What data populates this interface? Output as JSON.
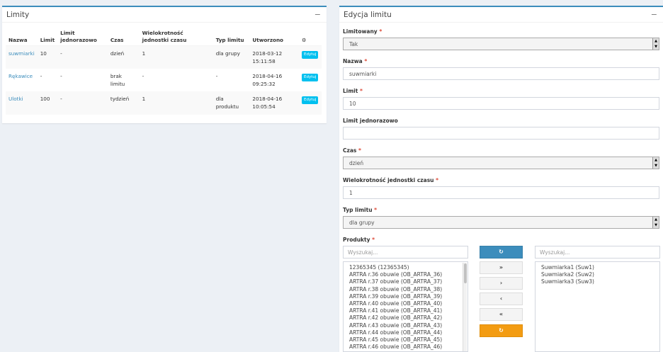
{
  "left_panel": {
    "title": "Limity",
    "collapse_icon": "−",
    "columns": [
      "Nazwa",
      "Limit",
      "Limit jednorazowo",
      "Czas",
      "Wielokrotność jednostki czasu",
      "Typ limitu",
      "Utworzono",
      "⚙"
    ],
    "rows": [
      {
        "name": "suwmiarki",
        "limit": "10",
        "once": "-",
        "time": "dzień",
        "mult": "1",
        "type": "dla grupy",
        "created": "2018-03-12 15:11:58",
        "action": "Edytuj"
      },
      {
        "name": "Rękawice",
        "limit": "-",
        "once": "-",
        "time": "brak limitu",
        "mult": "-",
        "type": "-",
        "created": "2018-04-16 09:25:32",
        "action": "Edytuj"
      },
      {
        "name": "Ulotki",
        "limit": "100",
        "once": "-",
        "time": "tydzień",
        "mult": "1",
        "type": "dla produktu",
        "created": "2018-04-16 10:05:54",
        "action": "Edytuj"
      }
    ]
  },
  "right_panel": {
    "title": "Edycja limitu",
    "collapse_icon": "−",
    "fields": {
      "limitowany": {
        "label": "Limitowany",
        "value": "Tak"
      },
      "nazwa": {
        "label": "Nazwa",
        "value": "suwmiarki"
      },
      "limit": {
        "label": "Limit",
        "value": "10"
      },
      "limit_once": {
        "label": "Limit jednorazowo",
        "value": ""
      },
      "czas": {
        "label": "Czas",
        "value": "dzień"
      },
      "mult": {
        "label": "Wielokrotność jednostki czasu",
        "value": "1"
      },
      "typ": {
        "label": "Typ limitu",
        "value": "dla grupy"
      },
      "produkty": {
        "label": "Produkty"
      }
    },
    "required_mark": "*",
    "dual_list": {
      "left_search_placeholder": "Wyszukaj...",
      "right_search_placeholder": "Wyszukaj...",
      "available": [
        "12365345 (12365345)",
        "ARTRA r.36 obuwie (OB_ARTRA_36)",
        "ARTRA r.37 obuwie (OB_ARTRA_37)",
        "ARTRA r.38 obuwie (OB_ARTRA_38)",
        "ARTRA r.39 obuwie (OB_ARTRA_39)",
        "ARTRA r.40 obuwie (OB_ARTRA_40)",
        "ARTRA r.41 obuwie (OB_ARTRA_41)",
        "ARTRA r.42 obuwie (OB_ARTRA_42)",
        "ARTRA r.43 obuwie (OB_ARTRA_43)",
        "ARTRA r.44 obuwie (OB_ARTRA_44)",
        "ARTRA r.45 obuwie (OB_ARTRA_45)",
        "ARTRA r.46 obuwie (OB_ARTRA_46)"
      ],
      "selected": [
        "Suwmiarka1 (Suw1)",
        "Suwmiarka2 (Suw2)",
        "Suwmiarka3 (Suw3)"
      ],
      "buttons": {
        "refresh": "↻",
        "move_all_right": "»",
        "move_right": "›",
        "move_left": "‹",
        "move_all_left": "«",
        "reset": "↻"
      }
    }
  }
}
